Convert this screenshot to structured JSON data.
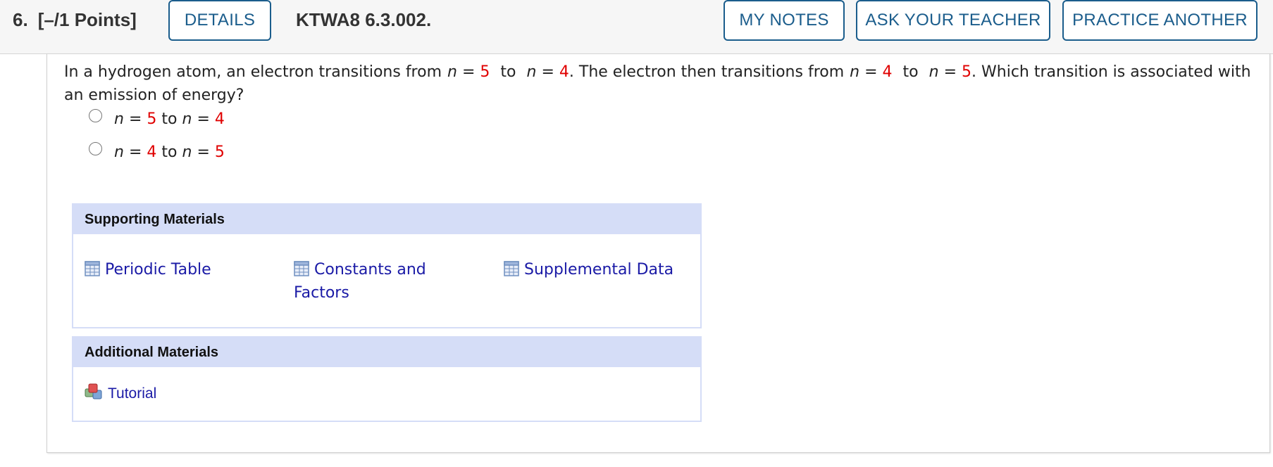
{
  "header": {
    "question_number": "6.",
    "points": "[–/1 Points]",
    "details_label": "DETAILS",
    "question_id": "KTWA8 6.3.002.",
    "my_notes_label": "MY NOTES",
    "ask_teacher_label": "ASK YOUR TEACHER",
    "practice_another_label": "PRACTICE ANOTHER"
  },
  "question": {
    "p1": "In a hydrogen atom, an electron transitions from",
    "p2": "to",
    "p3": ". The electron then transitions from",
    "p4": "to",
    "p5": ". Which transition is associated with an emission of energy?",
    "var": "n",
    "eq": "=",
    "a1": "5",
    "a2": "4",
    "b1": "4",
    "b2": "5"
  },
  "options": [
    {
      "var": "n",
      "eq": "=",
      "from": "5",
      "to_word": "to",
      "to": "4"
    },
    {
      "var": "n",
      "eq": "=",
      "from": "4",
      "to_word": "to",
      "to": "5"
    }
  ],
  "supporting": {
    "title": "Supporting Materials",
    "links": [
      "Periodic Table",
      "Constants and Factors",
      "Supplemental Data"
    ]
  },
  "additional": {
    "title": "Additional Materials",
    "links": [
      "Tutorial"
    ]
  },
  "colors": {
    "accent": "#1b5d8c",
    "link": "#1a1aa6",
    "value": "#e00000",
    "materials_header": "#d5ddf7"
  }
}
